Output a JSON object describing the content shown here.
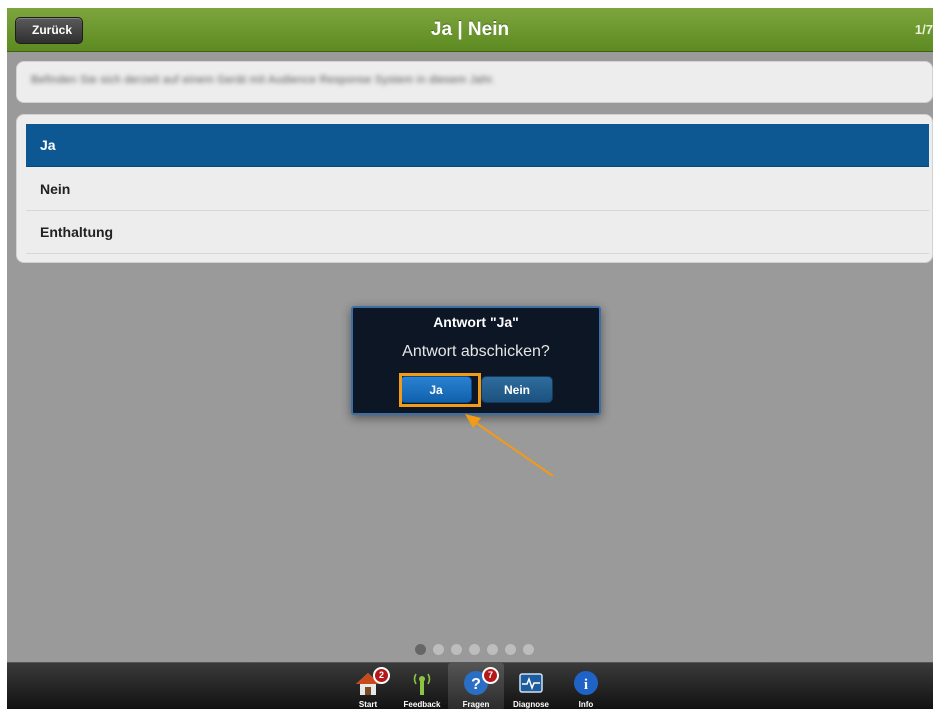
{
  "header": {
    "back_label": "Zurück",
    "title": "Ja | Nein",
    "counter": "1/7"
  },
  "question": {
    "text": "Befinden Sie sich derzeit auf einem Gerät mit Audience Response System in diesem Jahr."
  },
  "answers": [
    {
      "label": "Ja",
      "selected": true
    },
    {
      "label": "Nein",
      "selected": false
    },
    {
      "label": "Enthaltung",
      "selected": false
    }
  ],
  "dialog": {
    "title": "Antwort \"Ja\"",
    "message": "Antwort abschicken?",
    "yes_label": "Ja",
    "no_label": "Nein"
  },
  "pager": {
    "total": 7,
    "current": 1
  },
  "tabbar": {
    "tabs": [
      {
        "label": "Start",
        "icon": "home-icon",
        "badge": "2"
      },
      {
        "label": "Feedback",
        "icon": "feedback-antenna-icon",
        "badge": ""
      },
      {
        "label": "Fragen",
        "icon": "question-icon",
        "badge": "7"
      },
      {
        "label": "Diagnose",
        "icon": "diagnose-monitor-icon",
        "badge": ""
      },
      {
        "label": "Info",
        "icon": "info-icon",
        "badge": ""
      }
    ]
  },
  "colors": {
    "header_green": "#6b9a2e",
    "selected_blue": "#0d5792",
    "highlight_orange": "#f29b16"
  }
}
